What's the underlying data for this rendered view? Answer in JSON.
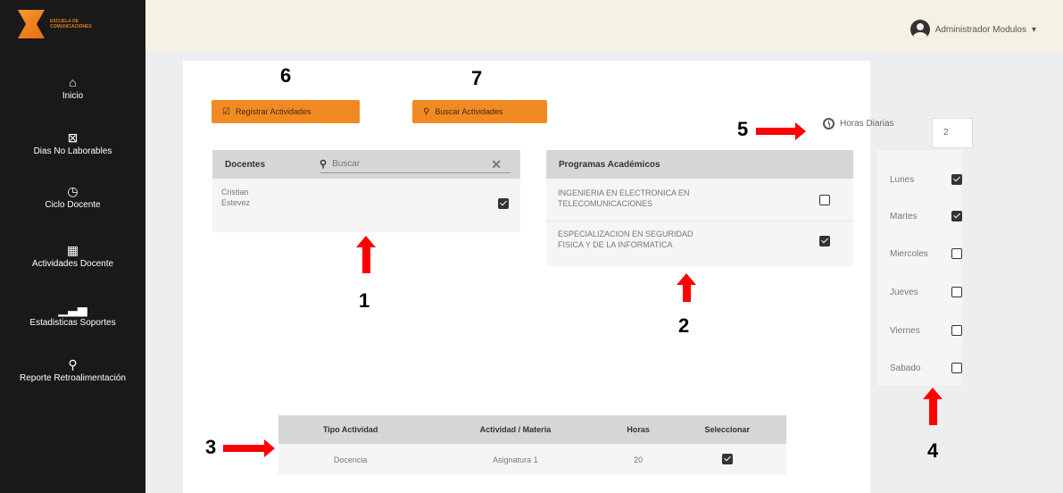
{
  "logo": {
    "text": "ESCUELA DE COMUNICACIONES"
  },
  "sidebar": {
    "items": [
      {
        "label": "Inicio",
        "icon": "home-icon"
      },
      {
        "label": "Dias No Laborables",
        "icon": "calendar-x-icon"
      },
      {
        "label": "Ciclo Docente",
        "icon": "clock-icon"
      },
      {
        "label": "Actividades Docente",
        "icon": "book-icon"
      },
      {
        "label": "Estadisticas Soportes",
        "icon": "bar-chart-icon"
      },
      {
        "label": "Reporte Retroalimentación",
        "icon": "feedback-icon"
      }
    ]
  },
  "header": {
    "user_name": "Administrador Modulos"
  },
  "toolbar": {
    "register_label": "Registrar Actividades",
    "search_label": "Buscar Actividades"
  },
  "hours": {
    "label": "Horas Diarias",
    "value": "2"
  },
  "docentes": {
    "header": "Docentes",
    "search_placeholder": "Buscar",
    "rows": [
      {
        "name_line1": "Cristian",
        "name_line2": "Estevez",
        "checked": true
      }
    ]
  },
  "programas": {
    "header": "Programas Académicos",
    "rows": [
      {
        "line1": "INGENIERIA EN ELECTRONICA EN",
        "line2": "TELECOMUNICACIONES",
        "checked": false
      },
      {
        "line1": "ESPECIALIZACION EN SEGURIDAD",
        "line2": "FISICA Y DE LA INFORMATICA",
        "checked": true
      }
    ]
  },
  "days": [
    {
      "label": "Lunes",
      "checked": true
    },
    {
      "label": "Martes",
      "checked": true
    },
    {
      "label": "Miercoles",
      "checked": false
    },
    {
      "label": "Jueves",
      "checked": false
    },
    {
      "label": "Viernes",
      "checked": false
    },
    {
      "label": "Sabado",
      "checked": false
    }
  ],
  "activities": {
    "headers": [
      "Tipo Actividad",
      "Actividad / Materia",
      "Horas",
      "Seleccionar"
    ],
    "rows": [
      {
        "tipo": "Docencia",
        "materia": "Asignatura 1",
        "horas": "20",
        "checked": true
      }
    ]
  },
  "annotations": {
    "a1": "1",
    "a2": "2",
    "a3": "3",
    "a4": "4",
    "a5": "5",
    "a6": "6",
    "a7": "7"
  },
  "colors": {
    "accent": "#f28a23",
    "sidebar": "#191919",
    "topbar": "#f5f1e3",
    "annotation": "#ff0000"
  }
}
